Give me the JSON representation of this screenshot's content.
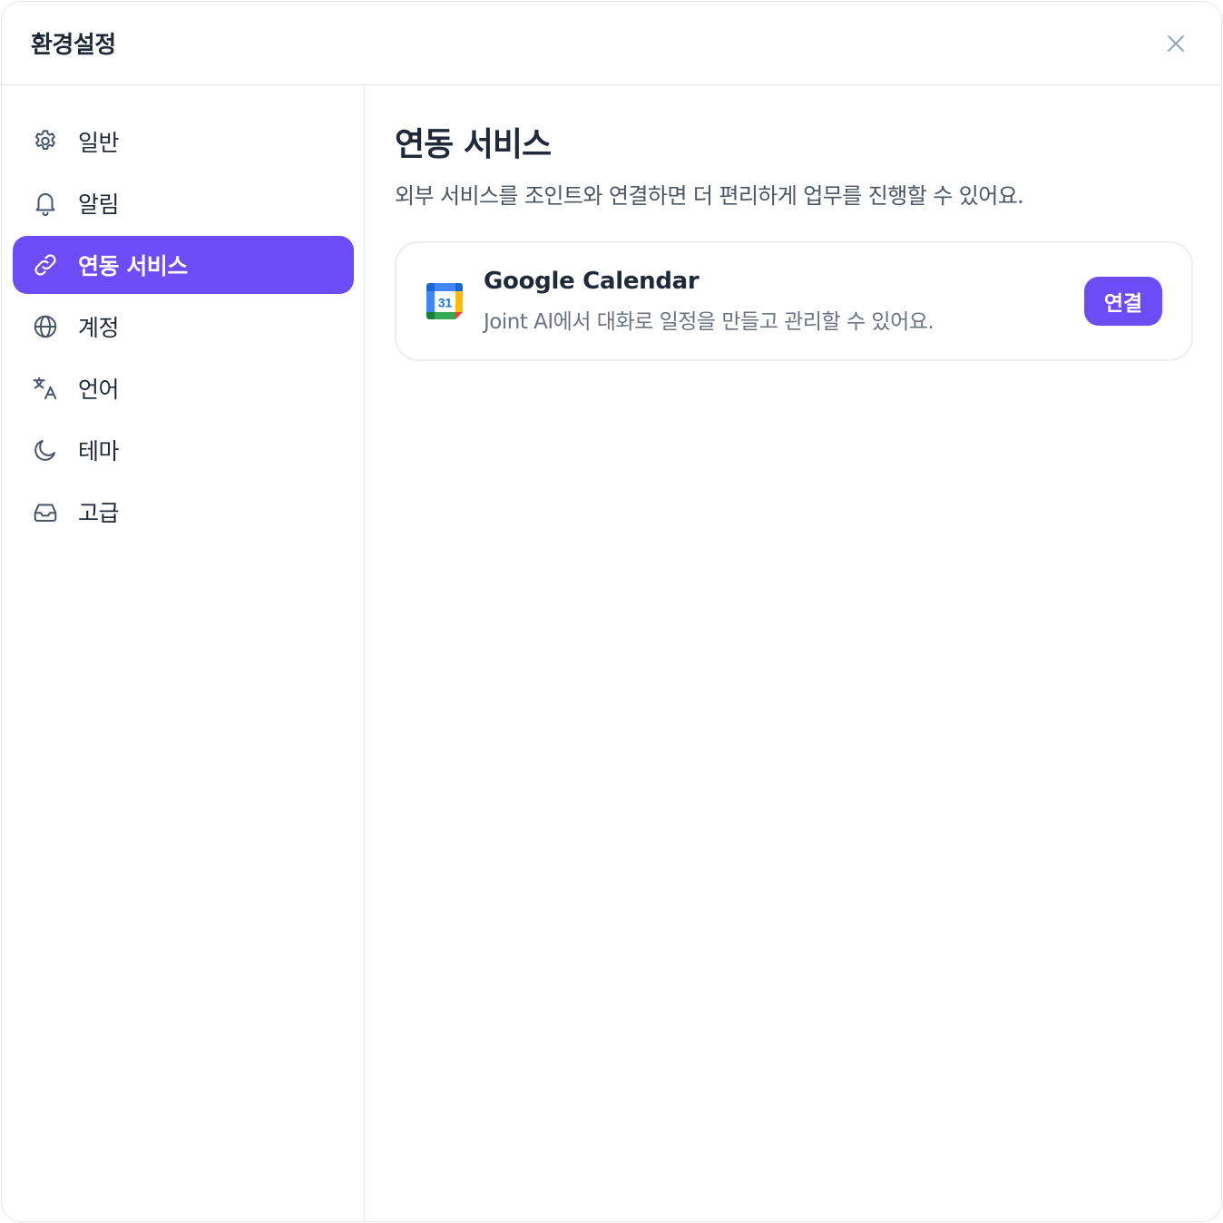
{
  "header": {
    "title": "환경설정",
    "close_icon": "close-icon"
  },
  "sidebar": {
    "items": [
      {
        "label": "일반",
        "icon": "gear-icon",
        "active": false
      },
      {
        "label": "알림",
        "icon": "bell-icon",
        "active": false
      },
      {
        "label": "연동 서비스",
        "icon": "link-icon",
        "active": true
      },
      {
        "label": "계정",
        "icon": "globe-icon",
        "active": false
      },
      {
        "label": "언어",
        "icon": "translate-icon",
        "active": false
      },
      {
        "label": "테마",
        "icon": "moon-icon",
        "active": false
      },
      {
        "label": "고급",
        "icon": "inbox-icon",
        "active": false
      }
    ]
  },
  "main": {
    "title": "연동 서비스",
    "description": "외부 서비스를 조인트와 연결하면 더 편리하게 업무를 진행할 수 있어요.",
    "services": [
      {
        "name": "Google Calendar",
        "description": "Joint AI에서 대화로 일정을 만들고 관리할 수 있어요.",
        "icon": "google-calendar-icon",
        "icon_text": "31",
        "button_label": "연결"
      }
    ]
  },
  "colors": {
    "accent": "#6b4cf6",
    "text": "#1f2937",
    "muted": "#6b7280",
    "border": "#e5e7eb"
  }
}
